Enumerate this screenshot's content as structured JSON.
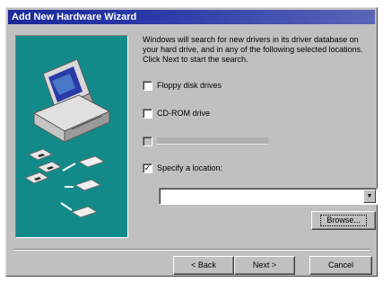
{
  "window": {
    "title": "Add New Hardware Wizard"
  },
  "illustration": {
    "icon": "computer-with-disks-icon"
  },
  "description": "Windows will search for new drivers in its driver database on your hard drive, and in any of the following selected locations. Click Next to start the search.",
  "options": [
    {
      "label": "Floppy disk drives",
      "checked": false,
      "enabled": true
    },
    {
      "label": "CD-ROM drive",
      "checked": false,
      "enabled": true
    },
    {
      "label": "",
      "checked": false,
      "enabled": false
    },
    {
      "label": "Specify a location:",
      "checked": true,
      "enabled": true
    }
  ],
  "location": {
    "value": ""
  },
  "buttons": {
    "browse": "Browse...",
    "back": "< Back",
    "next": "Next >",
    "cancel": "Cancel"
  },
  "colors": {
    "title_bar": "#1a2a9a",
    "panel": "#c0c0c0",
    "illustration_bg": "#138a8a"
  }
}
